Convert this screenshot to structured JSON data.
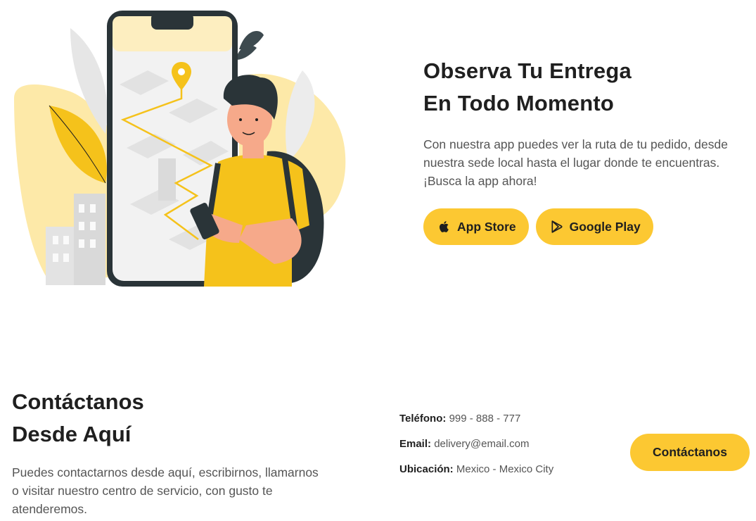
{
  "app_section": {
    "title_line1": "Observa Tu Entrega",
    "title_line2": "En Todo Momento",
    "description": "Con nuestra app puedes ver la ruta de tu pedido, desde nuestra sede local hasta el lugar donde te encuentras. ¡Busca la app ahora!",
    "buttons": [
      {
        "label": "App Store",
        "icon": "apple-icon"
      },
      {
        "label": "Google Play",
        "icon": "google-play-icon"
      }
    ]
  },
  "contact_section": {
    "title_line1": "Contáctanos",
    "title_line2": "Desde Aquí",
    "description": "Puedes contactarnos desde aquí, escribirnos, llamarnos o visitar nuestro centro de servicio, con gusto te atenderemos.",
    "phone_label": "Teléfono:",
    "phone_value": "999 - 888 - 777",
    "email_label": "Email:",
    "email_value": "delivery@email.com",
    "location_label": "Ubicación:",
    "location_value": "Mexico - Mexico City",
    "button_label": "Contáctanos"
  },
  "colors": {
    "accent": "#fcc832",
    "text_dark": "#1f1f1f",
    "text_muted": "#555555"
  }
}
